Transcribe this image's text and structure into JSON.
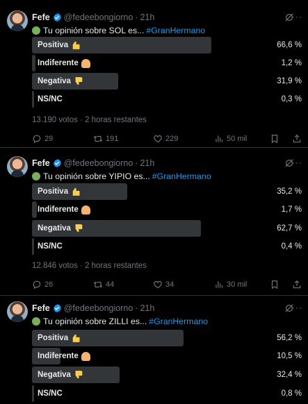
{
  "colors": {
    "background": "#000000",
    "text": "#e7e9ea",
    "muted": "#71767b",
    "bar": "#333639",
    "link": "#1d9bf0",
    "verified": "#1d9bf0"
  },
  "tweets": [
    {
      "author": "Fefe",
      "handle": "@fedeebongiorno",
      "dot": "·",
      "time": "21h",
      "more": "···",
      "text": "Tu opinión sobre SOL es...",
      "hashtag": "#GranHermano",
      "options": [
        {
          "label": "Positiva",
          "emoji": "thumbs-up",
          "pct": "66,6 %",
          "value": 66.6
        },
        {
          "label": "Indiferente",
          "emoji": "person-shrugging",
          "pct": "1,2 %",
          "value": 1.2
        },
        {
          "label": "Negativa",
          "emoji": "thumbs-down",
          "pct": "31,9 %",
          "value": 31.9
        },
        {
          "label": "NS/NC",
          "emoji": "",
          "pct": "0,3 %",
          "value": 0.3
        }
      ],
      "votes": "13.190 votos · 2 horas restantes",
      "replies": "29",
      "retweets": "191",
      "likes": "229",
      "views": "50 mil"
    },
    {
      "author": "Fefe",
      "handle": "@fedeebongiorno",
      "dot": "·",
      "time": "21h",
      "more": "···",
      "text": "Tu opinión sobre YIPIO es...",
      "hashtag": "#GranHermano",
      "options": [
        {
          "label": "Positiva",
          "emoji": "thumbs-up",
          "pct": "35,2 %",
          "value": 35.2
        },
        {
          "label": "Indiferente",
          "emoji": "person-shrugging",
          "pct": "1,7 %",
          "value": 1.7
        },
        {
          "label": "Negativa",
          "emoji": "thumbs-down",
          "pct": "62,7 %",
          "value": 62.7
        },
        {
          "label": "NS/NC",
          "emoji": "",
          "pct": "0,4 %",
          "value": 0.4
        }
      ],
      "votes": "12.846 votos · 2 horas restantes",
      "replies": "26",
      "retweets": "44",
      "likes": "34",
      "views": "30 mil"
    },
    {
      "author": "Fefe",
      "handle": "@fedeebongiorno",
      "dot": "·",
      "time": "21h",
      "more": "···",
      "text": "Tu opinión sobre ZILLI es...",
      "hashtag": "#GranHermano",
      "options": [
        {
          "label": "Positiva",
          "emoji": "thumbs-up",
          "pct": "56,2 %",
          "value": 56.2
        },
        {
          "label": "Indiferente",
          "emoji": "person-shrugging",
          "pct": "10,5 %",
          "value": 10.5
        },
        {
          "label": "Negativa",
          "emoji": "thumbs-down",
          "pct": "32,4 %",
          "value": 32.4
        },
        {
          "label": "NS/NC",
          "emoji": "",
          "pct": "0,8 %",
          "value": 0.8
        }
      ]
    }
  ]
}
